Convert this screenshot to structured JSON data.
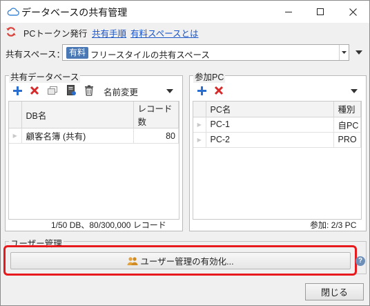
{
  "window": {
    "title": "データベースの共有管理"
  },
  "linkbar": {
    "issue_token": "PCトークン発行",
    "share_procedure": "共有手順",
    "about_paid_space": "有料スペースとは"
  },
  "space": {
    "label": "共有スペース：",
    "badge": "有料",
    "selected": "フリースタイルの共有スペース"
  },
  "shared_db": {
    "legend": "共有データベース",
    "rename_label": "名前変更",
    "columns": [
      "DB名",
      "レコード数"
    ],
    "rows": [
      {
        "name": "顧客名簿 (共有)",
        "count": "80"
      }
    ],
    "footer": "1/50 DB、80/300,000 レコード"
  },
  "participants": {
    "legend": "参加PC",
    "columns": [
      "PC名",
      "種別"
    ],
    "rows": [
      {
        "name": "PC-1",
        "type": "自PC"
      },
      {
        "name": "PC-2",
        "type": "PRO"
      }
    ],
    "footer": "参加: 2/3 PC"
  },
  "user_mgmt": {
    "legend": "ユーザー管理",
    "activate_label": "ユーザー管理の有効化...",
    "help": "?"
  },
  "close_label": "閉じる",
  "icons": {
    "app": "cloud-icon",
    "refresh": "refresh-icon",
    "add": "plus-icon",
    "delete": "x-icon",
    "copy": "windows-icon",
    "export": "doc-icon",
    "trash": "trash-icon",
    "users": "users-icon"
  },
  "colors": {
    "accent": "#1a55c8",
    "add_icon": "#2a6fd0",
    "delete_icon": "#d42a2a",
    "highlight": "#e8191c",
    "badge": "#4a78b5"
  }
}
